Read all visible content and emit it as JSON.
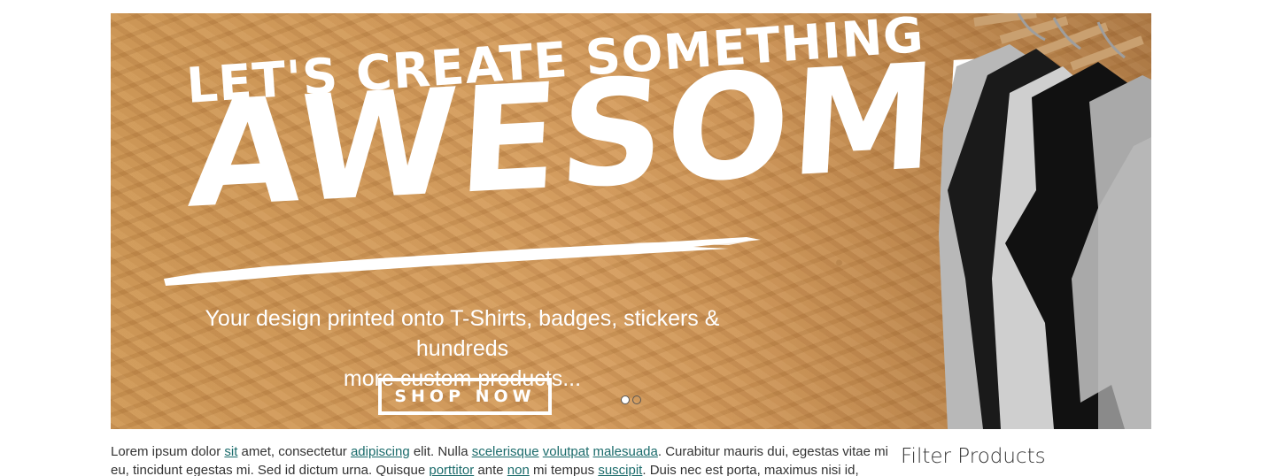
{
  "hero": {
    "headline_small": "LET'S CREATE SOMETHING",
    "headline_big": "AWESOME",
    "tagline_line1": "Your design printed onto T-Shirts, badges, stickers & hundreds",
    "tagline_line2": "more custom products...",
    "cta_label": "SHOP NOW",
    "slide_count": 2,
    "active_slide": 1
  },
  "content": {
    "seg1": "Lorem ipsum dolor ",
    "link1": "sit",
    "seg2": " amet, consectetur ",
    "link2": "adipiscing",
    "seg3": " elit. Nulla ",
    "link3": "scelerisque",
    "seg4": " ",
    "link4": "volutpat",
    "seg5": " ",
    "link5": "malesuada",
    "seg6": ". Curabitur mauris dui, egestas vitae mi eu, tincidunt egestas mi. Sed id dictum urna. Quisque ",
    "link6": "porttitor",
    "seg7": " ante ",
    "link7": "non",
    "seg8": " mi tempus ",
    "link8": "suscipit",
    "seg9": ". Duis nec est porta, maximus nisi id, malesuada"
  },
  "sidebar": {
    "filter_title": "Filter Products"
  },
  "colors": {
    "link": "#1a6b6b",
    "text": "#333333",
    "hero_wood": "#d7a160"
  }
}
